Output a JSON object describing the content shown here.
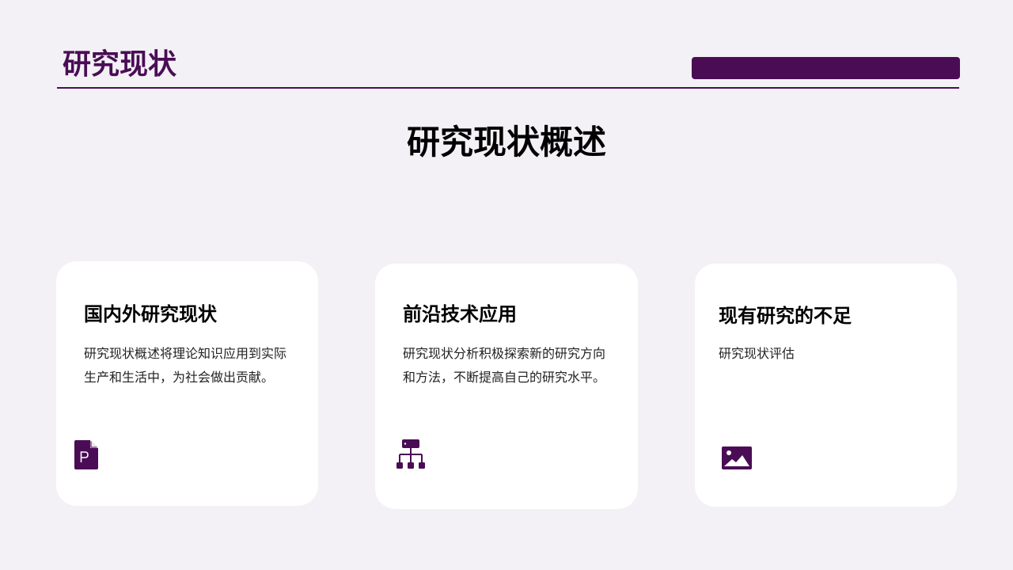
{
  "header": {
    "title": "研究现状"
  },
  "main": {
    "title": "研究现状概述"
  },
  "cards": [
    {
      "title": "国内外研究现状",
      "text": "研究现状概述将理论知识应用到实际生产和生活中，为社会做出贡献。",
      "icon": "powerpoint-file-icon"
    },
    {
      "title": "前沿技术应用",
      "text": "研究现状分析积极探索新的研究方向和方法，不断提高自己的研究水平。",
      "icon": "hierarchy-icon"
    },
    {
      "title": "现有研究的不足",
      "text": "研究现状评估",
      "icon": "image-icon"
    }
  ],
  "colors": {
    "accent": "#4a0d55",
    "background": "#f3f1f5",
    "card": "#ffffff"
  }
}
